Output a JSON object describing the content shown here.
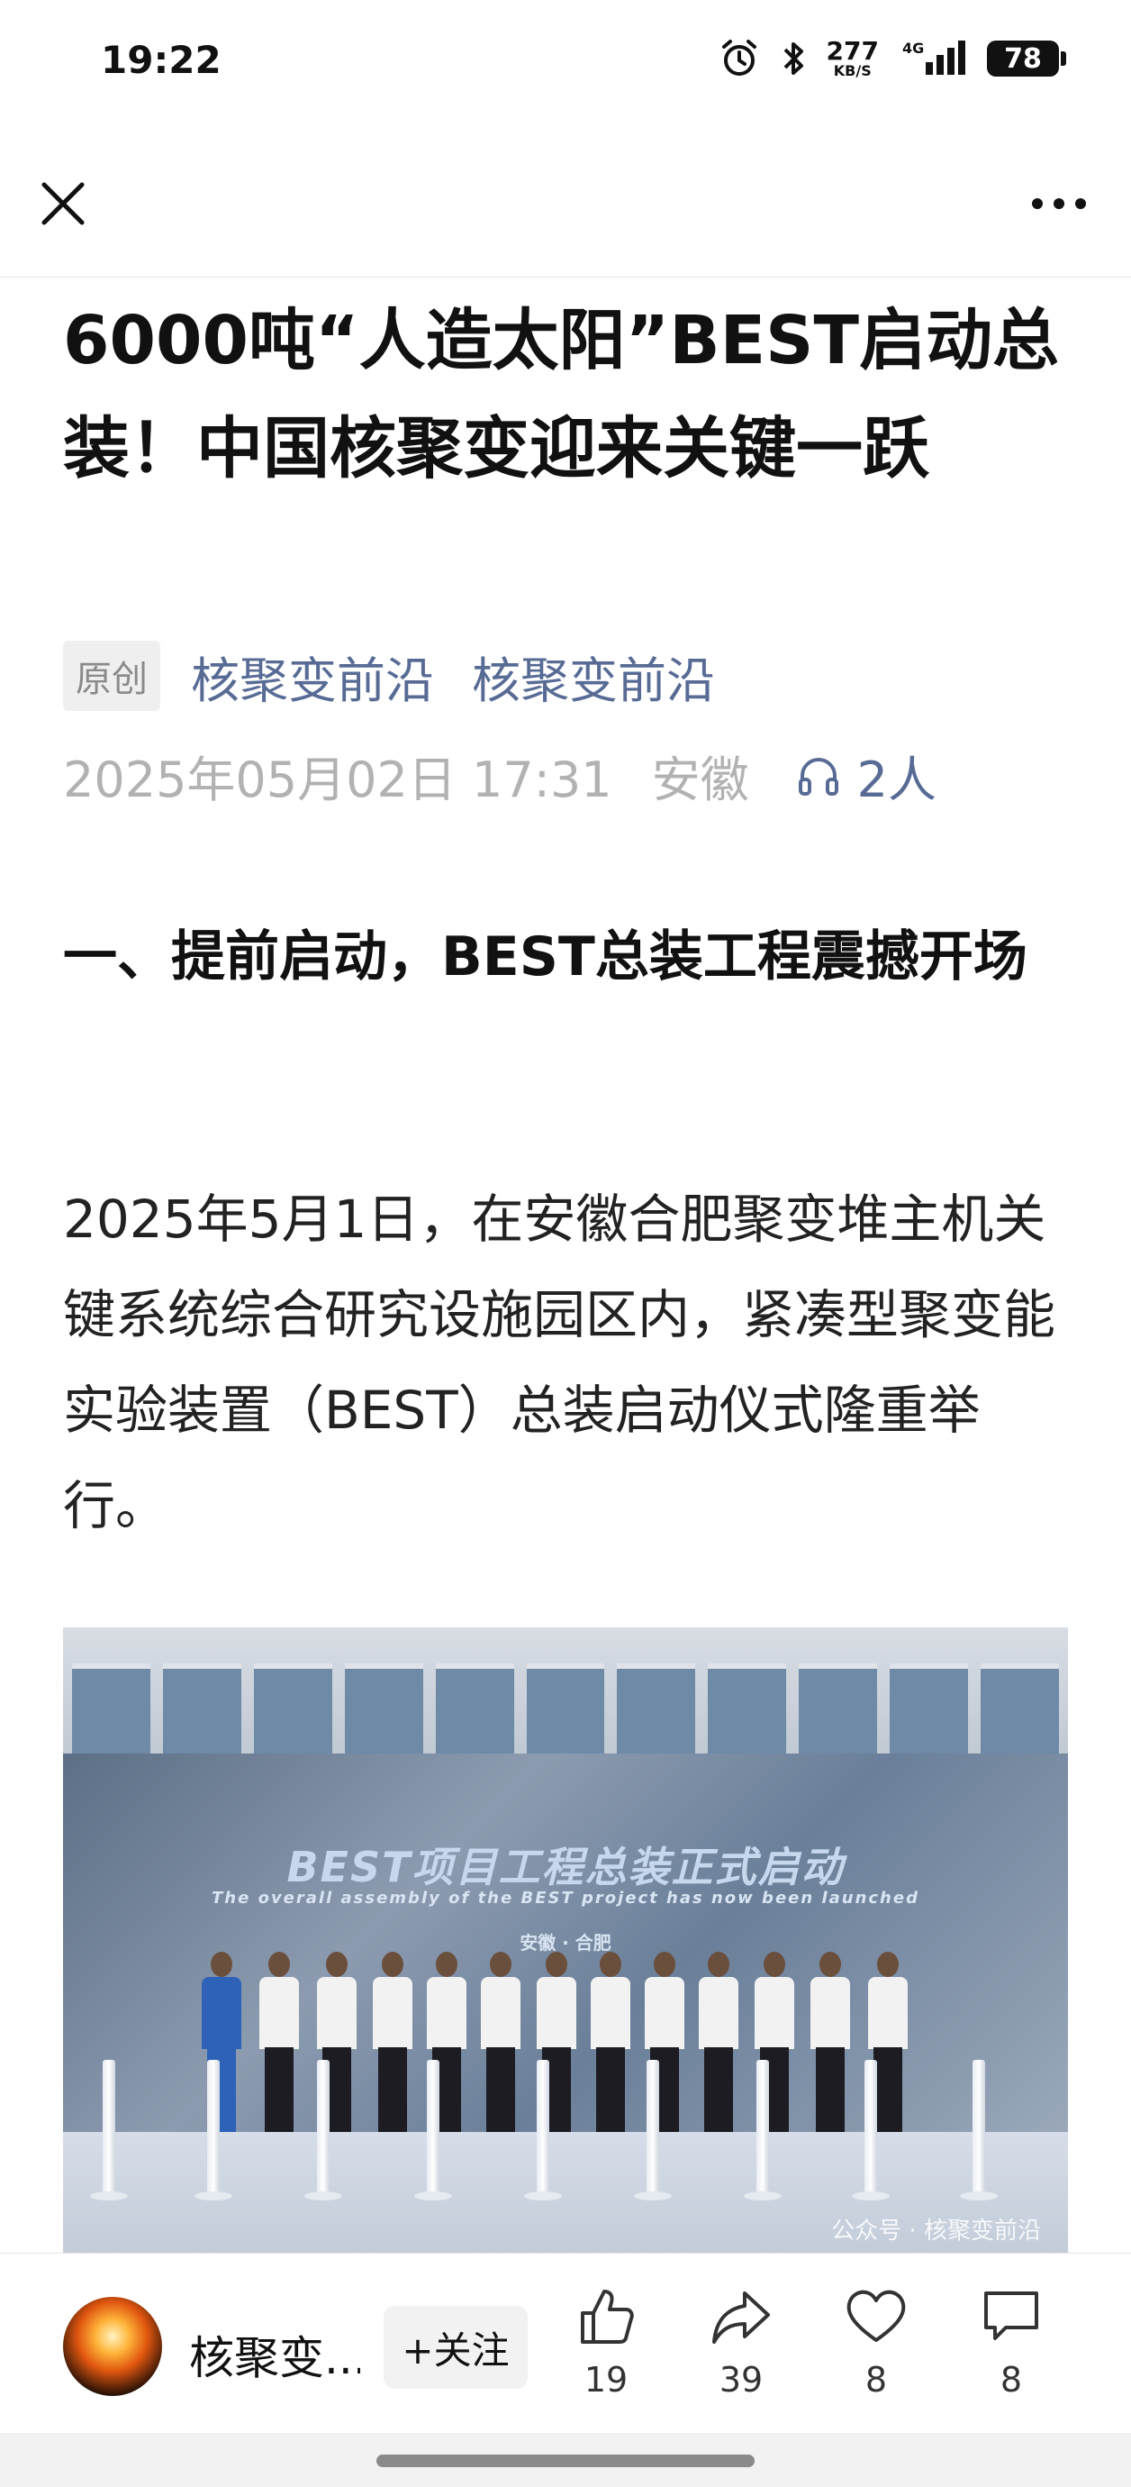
{
  "status_bar": {
    "time": "19:22",
    "net_speed_value": "277",
    "net_speed_unit": "KB/S",
    "network": "4G",
    "battery": "78"
  },
  "nav": {
    "close_icon": "close-icon",
    "more_icon": "more-icon"
  },
  "article": {
    "title": "6000吨“人造太阳”BEST启动总装！中国核聚变迎来关键一跃",
    "original_badge": "原创",
    "author": "核聚变前沿",
    "account": "核聚变前沿",
    "date": "2025年05月02日 17:31",
    "location": "安徽",
    "listeners": "2人",
    "section_heading": "一、提前启动，BEST总装工程震撼开场",
    "paragraph": "2025年5月1日，在安徽合肥聚变堆主机关键系统综合研究设施园区内，紧凑型聚变能实验装置（BEST）总装启动仪式隆重举行。",
    "photo": {
      "screen_title": "BEST项目工程总装正式启动",
      "screen_subtitle": "The overall assembly of the BEST project has now been launched",
      "screen_location": "安徽 · 合肥",
      "watermark": "公众号 · 核聚变前沿"
    }
  },
  "bottom_bar": {
    "author_name": "核聚变...",
    "follow_label": "+关注",
    "like_count": "19",
    "share_count": "39",
    "favorite_count": "8",
    "comment_count": "8"
  },
  "colors": {
    "link": "#576b95",
    "meta_gray": "#b2b2b2",
    "text": "#111111"
  }
}
